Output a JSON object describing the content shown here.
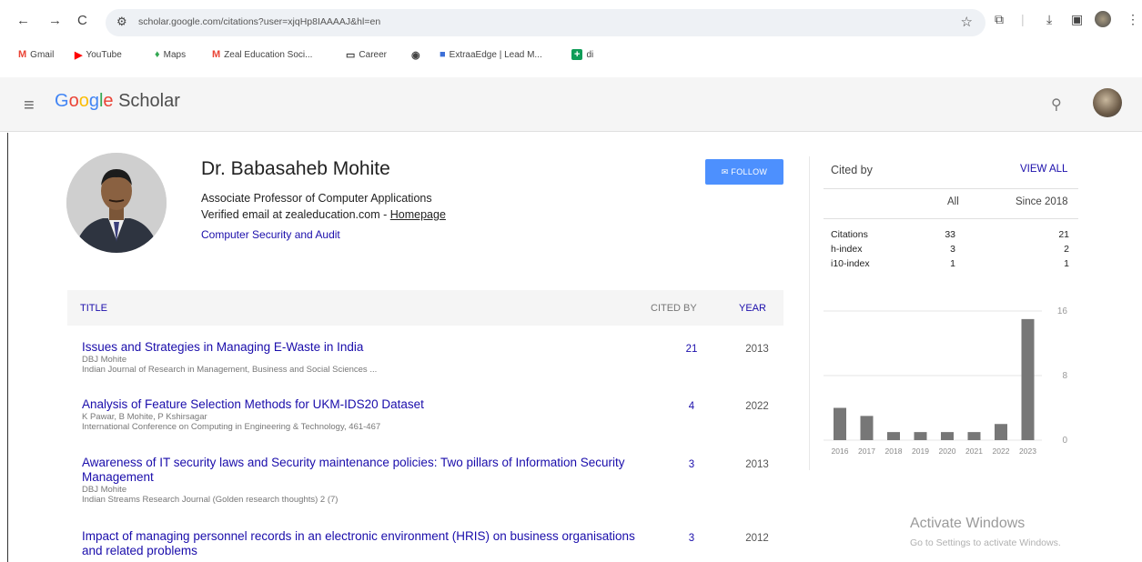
{
  "browser": {
    "nav": {
      "back": "←",
      "forward": "→",
      "reload": "C"
    },
    "url": "scholar.google.com/citations?user=xjqHp8IAAAAJ&hl=en",
    "toolbar_icons": [
      "star-icon",
      "extensions-icon",
      "download-icon",
      "sidepanel-icon",
      "profile-icon",
      "more-icon"
    ]
  },
  "bookmarks": [
    {
      "label": "Gmail",
      "icon": "M",
      "color": "#ea4335"
    },
    {
      "label": "YouTube",
      "icon": "▶",
      "color": "#ff0000"
    },
    {
      "label": "Maps",
      "icon": "♦",
      "color": "#34a853"
    },
    {
      "label": "Zeal Education Soci...",
      "icon": "M",
      "color": "#ea4335"
    },
    {
      "label": "Career",
      "icon": "▭",
      "color": "#444444"
    },
    {
      "label": "",
      "icon": "◉",
      "color": "#444444"
    },
    {
      "label": "ExtraaEdge | Lead M...",
      "icon": "■",
      "color": "#3b6fd8"
    },
    {
      "label": "di",
      "icon": "+",
      "color": "#0f9d58"
    }
  ],
  "scholar": {
    "logo_google": "Google",
    "logo_scholar": "Scholar"
  },
  "profile": {
    "name": "Dr. Babasaheb Mohite",
    "affiliation": "Associate Professor of Computer Applications",
    "email_text": "Verified email at zealeducation.com - ",
    "homepage": "Homepage",
    "interests": "Computer Security and Audit",
    "follow_label": "FOLLOW"
  },
  "table": {
    "headers": {
      "title": "TITLE",
      "cited_by": "CITED BY",
      "year": "YEAR"
    },
    "rows": [
      {
        "title": "Issues and Strategies in Managing E-Waste in India",
        "authors": "DBJ Mohite",
        "publication": "Indian Journal of Research in Management, Business and Social Sciences ...",
        "cited": "21",
        "year": "2013"
      },
      {
        "title": "Analysis of Feature Selection Methods for UKM-IDS20 Dataset",
        "authors": "K Pawar, B Mohite, P Kshirsagar",
        "publication": "International Conference on Computing in Engineering & Technology, 461-467",
        "cited": "4",
        "year": "2022"
      },
      {
        "title": "Awareness of IT security laws and Security maintenance policies: Two pillars of Information Security Management",
        "authors": "DBJ Mohite",
        "publication": "Indian Streams Research Journal (Golden research thoughts) 2 (7)",
        "cited": "3",
        "year": "2013"
      },
      {
        "title": "Impact of managing personnel records in an electronic environment (HRIS) on business organisations and related problems",
        "authors": "",
        "publication": "",
        "cited": "3",
        "year": "2012"
      }
    ]
  },
  "cited_by": {
    "title": "Cited by",
    "view_all": "VIEW ALL",
    "col_all": "All",
    "col_since": "Since 2018",
    "metrics": [
      {
        "label": "Citations",
        "all": "33",
        "since": "21"
      },
      {
        "label": "h-index",
        "all": "3",
        "since": "2"
      },
      {
        "label": "i10-index",
        "all": "1",
        "since": "1"
      }
    ]
  },
  "chart_data": {
    "type": "bar",
    "categories": [
      "2016",
      "2017",
      "2018",
      "2019",
      "2020",
      "2021",
      "2022",
      "2023"
    ],
    "values": [
      4,
      3,
      1,
      1,
      1,
      1,
      2,
      15
    ],
    "ylim": [
      0,
      16
    ],
    "yticks": [
      "16",
      "8",
      "0"
    ],
    "bar_color": "#777777"
  },
  "watermark": {
    "line1": "Activate Windows",
    "line2": "Go to Settings to activate Windows."
  }
}
